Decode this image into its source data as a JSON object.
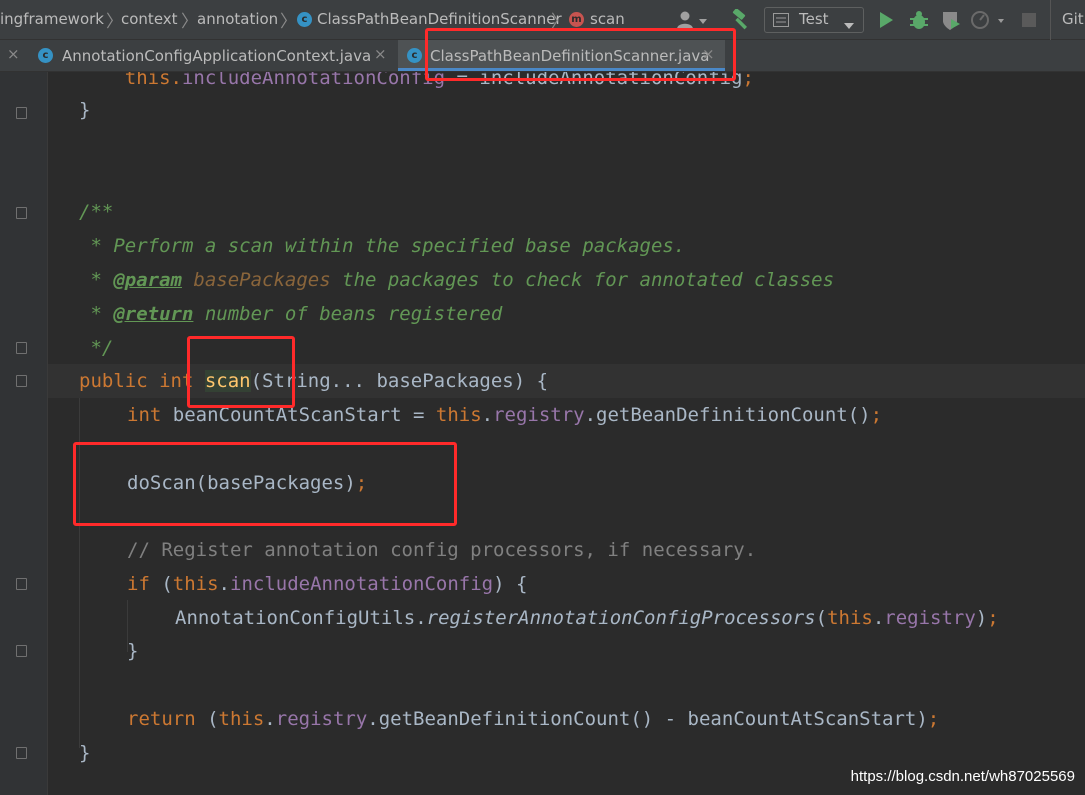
{
  "breadcrumbs": {
    "items": [
      "ingframework",
      "context",
      "annotation",
      "ClassPathBeanDefinitionScanner",
      "scan"
    ],
    "class_icon_letter": "c",
    "method_icon_letter": "m"
  },
  "toolbar": {
    "run_config": "Test",
    "git_label": "Git:"
  },
  "tabs": [
    {
      "label": "AnnotationConfigApplicationContext.java",
      "active": false
    },
    {
      "label": "ClassPathBeanDefinitionScanner.java",
      "active": true
    }
  ],
  "code": {
    "line_top_partial": {
      "t0": "\tthis.",
      "t1": "includeAnnotationConfig",
      "t2": " = includeAnnotationConfig",
      "t3": ";"
    },
    "line_close_1": "}",
    "doc_open": "/**",
    "doc_desc": " * Perform a scan within the specified base packages.",
    "doc_param": {
      "t0": " * ",
      "t1": "@param",
      "t2": " ",
      "t3": "basePackages",
      "t4": " the packages to check for annotated classes"
    },
    "doc_return": {
      "t0": " * ",
      "t1": "@return",
      "t2": " number of beans registered"
    },
    "doc_close": " */",
    "signature": {
      "t0": "public int ",
      "t1": "scan",
      "t2": "(String... basePackages) {"
    },
    "count_line": {
      "t0": "int",
      "t1": " beanCountAtScanStart = ",
      "t2": "this",
      "t3": ".",
      "t4": "registry",
      "t5": ".getBeanDefinitionCount()",
      "t6": ";"
    },
    "doscan_line": {
      "t0": "doScan(basePackages)",
      "t1": ";"
    },
    "comment_line": "// Register annotation config processors, if necessary.",
    "if_line": {
      "t0": "if",
      "t1": " (",
      "t2": "this",
      "t3": ".",
      "t4": "includeAnnotationConfig",
      "t5": ") {"
    },
    "utils_line": {
      "t0": "AnnotationConfigUtils.",
      "t1": "registerAnnotationConfigProcessors",
      "t2": "(",
      "t3": "this",
      "t4": ".",
      "t5": "registry",
      "t6": ")",
      "t7": ";"
    },
    "close_if": "}",
    "return_line": {
      "t0": "return",
      "t1": " (",
      "t2": "this",
      "t3": ".",
      "t4": "registry",
      "t5": ".getBeanDefinitionCount() - beanCountAtScanStart)",
      "t6": ";"
    },
    "close_method": "}"
  },
  "watermark": "https://blog.csdn.net/wh87025569",
  "colors": {
    "keyword": "#cc7832",
    "field": "#9876aa",
    "doc_comment": "#629755",
    "method_decl": "#ffc66d",
    "highlight_box": "#ff2a2a",
    "tab_underline": "#4a88c7"
  }
}
